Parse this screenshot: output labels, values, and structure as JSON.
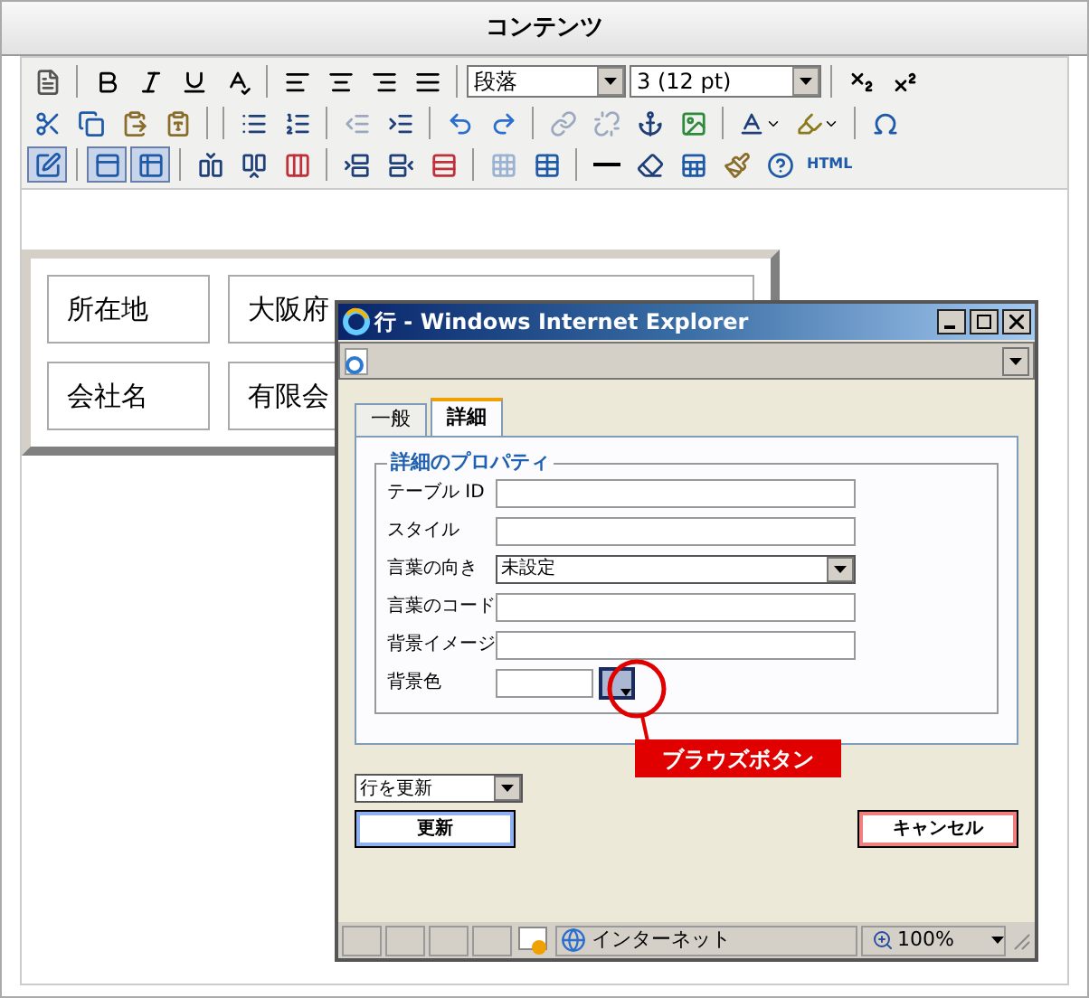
{
  "editor": {
    "title": "コンテンツ",
    "toolbar": [
      [
        {
          "kind": "button",
          "pressed": false,
          "disabled": false
        },
        {
          "kind": "sep"
        },
        {
          "kind": "button",
          "pressed": false,
          "disabled": false
        },
        {
          "kind": "button",
          "pressed": false,
          "disabled": false
        },
        {
          "kind": "button",
          "pressed": false,
          "disabled": false
        },
        {
          "kind": "button",
          "pressed": false,
          "disabled": false
        },
        {
          "kind": "sep"
        },
        {
          "kind": "button",
          "pressed": false,
          "disabled": false
        },
        {
          "kind": "button",
          "pressed": false,
          "disabled": false
        },
        {
          "kind": "button",
          "pressed": false,
          "disabled": false
        },
        {
          "kind": "button",
          "pressed": false,
          "disabled": false
        },
        {
          "kind": "sep"
        },
        {
          "kind": "select",
          "value": "段落"
        },
        {
          "kind": "select",
          "value": "3 (12 pt)"
        },
        {
          "kind": "sep"
        },
        {
          "kind": "button",
          "pressed": false,
          "disabled": false
        },
        {
          "kind": "button",
          "pressed": false,
          "disabled": false
        }
      ],
      [
        {
          "kind": "button",
          "pressed": false,
          "disabled": false
        },
        {
          "kind": "button",
          "pressed": false,
          "disabled": false
        },
        {
          "kind": "button",
          "pressed": false,
          "disabled": false
        },
        {
          "kind": "button",
          "pressed": false,
          "disabled": false
        },
        {
          "kind": "sep"
        },
        {
          "kind": "sep"
        },
        {
          "kind": "button",
          "pressed": false,
          "disabled": false
        },
        {
          "kind": "button",
          "pressed": false,
          "disabled": false
        },
        {
          "kind": "sep"
        },
        {
          "kind": "button",
          "pressed": false,
          "disabled": true
        },
        {
          "kind": "button",
          "pressed": false,
          "disabled": false
        },
        {
          "kind": "sep"
        },
        {
          "kind": "button",
          "pressed": false,
          "disabled": false
        },
        {
          "kind": "button",
          "pressed": false,
          "disabled": false
        },
        {
          "kind": "sep"
        },
        {
          "kind": "button",
          "pressed": false,
          "disabled": true
        },
        {
          "kind": "button",
          "pressed": false,
          "disabled": true
        },
        {
          "kind": "button",
          "pressed": false,
          "disabled": false
        },
        {
          "kind": "button",
          "pressed": false,
          "disabled": false
        },
        {
          "kind": "sep"
        },
        {
          "kind": "button",
          "pressed": false,
          "disabled": false
        },
        {
          "kind": "button",
          "pressed": false,
          "disabled": false
        },
        {
          "kind": "sep"
        },
        {
          "kind": "button",
          "pressed": false,
          "disabled": false
        }
      ],
      [
        {
          "kind": "button",
          "pressed": true,
          "disabled": false
        },
        {
          "kind": "sep"
        },
        {
          "kind": "button",
          "pressed": true,
          "disabled": false
        },
        {
          "kind": "button",
          "pressed": true,
          "disabled": false
        },
        {
          "kind": "sep"
        },
        {
          "kind": "button",
          "pressed": false,
          "disabled": false
        },
        {
          "kind": "button",
          "pressed": false,
          "disabled": false
        },
        {
          "kind": "button",
          "pressed": false,
          "disabled": false
        },
        {
          "kind": "sep"
        },
        {
          "kind": "button",
          "pressed": false,
          "disabled": false
        },
        {
          "kind": "button",
          "pressed": false,
          "disabled": false
        },
        {
          "kind": "button",
          "pressed": false,
          "disabled": false
        },
        {
          "kind": "sep"
        },
        {
          "kind": "button",
          "pressed": false,
          "disabled": true
        },
        {
          "kind": "button",
          "pressed": false,
          "disabled": false
        },
        {
          "kind": "sep"
        },
        {
          "kind": "button",
          "pressed": false,
          "disabled": false
        },
        {
          "kind": "button",
          "pressed": false,
          "disabled": false
        },
        {
          "kind": "button",
          "pressed": false,
          "disabled": false
        },
        {
          "kind": "button",
          "pressed": false,
          "disabled": false
        },
        {
          "kind": "button",
          "pressed": false,
          "disabled": false
        },
        {
          "kind": "text",
          "label": "HTML"
        }
      ]
    ],
    "table": {
      "rows": [
        [
          "所在地",
          "大阪府"
        ],
        [
          "会社名",
          "有限会"
        ]
      ]
    }
  },
  "dialog": {
    "title": "行 - Windows Internet Explorer",
    "tabs": [
      {
        "label": "一般",
        "selected": false
      },
      {
        "label": "詳細",
        "selected": true
      }
    ],
    "group": "詳細のプロパティ",
    "fields": [
      {
        "kind": "text",
        "label": "テーブル ID"
      },
      {
        "kind": "text",
        "label": "スタイル"
      },
      {
        "kind": "select",
        "label": "言葉の向き",
        "value": "未設定"
      },
      {
        "kind": "text",
        "label": "言葉のコード"
      },
      {
        "kind": "text",
        "label": "背景イメージ"
      },
      {
        "kind": "color",
        "label": "背景色"
      }
    ],
    "callout": "ブラウズボタン",
    "action_select": "行を更新",
    "buttons": [
      {
        "label": "更新",
        "kind": "primary"
      },
      {
        "label": "キャンセル",
        "kind": "cancel"
      }
    ],
    "status": {
      "zone": "インターネット",
      "zoom": "100%"
    }
  }
}
